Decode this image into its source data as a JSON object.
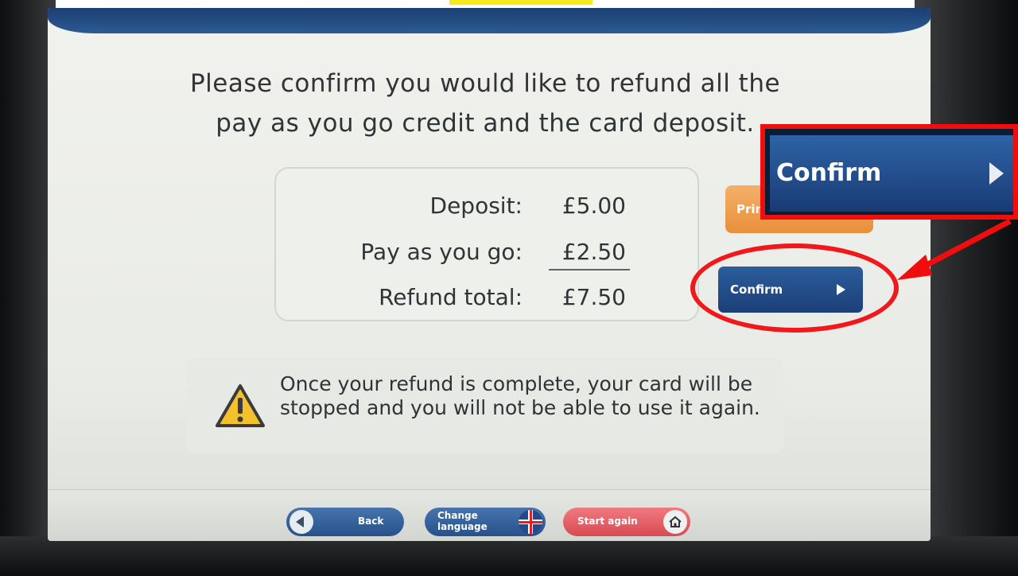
{
  "prompt": {
    "line1": "Please confirm you would like to refund all the",
    "line2": "pay as you go credit and the card deposit."
  },
  "summary": {
    "rows": [
      {
        "label": "Deposit:",
        "amount": "£5.00"
      },
      {
        "label": "Pay as you go:",
        "amount": "£2.50"
      },
      {
        "label": "Refund total:",
        "amount": "£7.50"
      }
    ]
  },
  "buttons": {
    "print_label": "Prin",
    "confirm_label": "Confirm"
  },
  "warning": {
    "text": "Once your refund is complete, your card will be stopped and you will not be able to use it again."
  },
  "nav": {
    "back_label": "Back",
    "change_language_line1": "Change",
    "change_language_line2": "language",
    "start_again_label": "Start again"
  },
  "annotation": {
    "zoom_label": "Confirm",
    "highlight_color": "#f10d0d"
  },
  "icons": [
    "back-arrow-icon",
    "uk-flag-icon",
    "home-icon",
    "warning-icon",
    "play-arrow-icon"
  ]
}
